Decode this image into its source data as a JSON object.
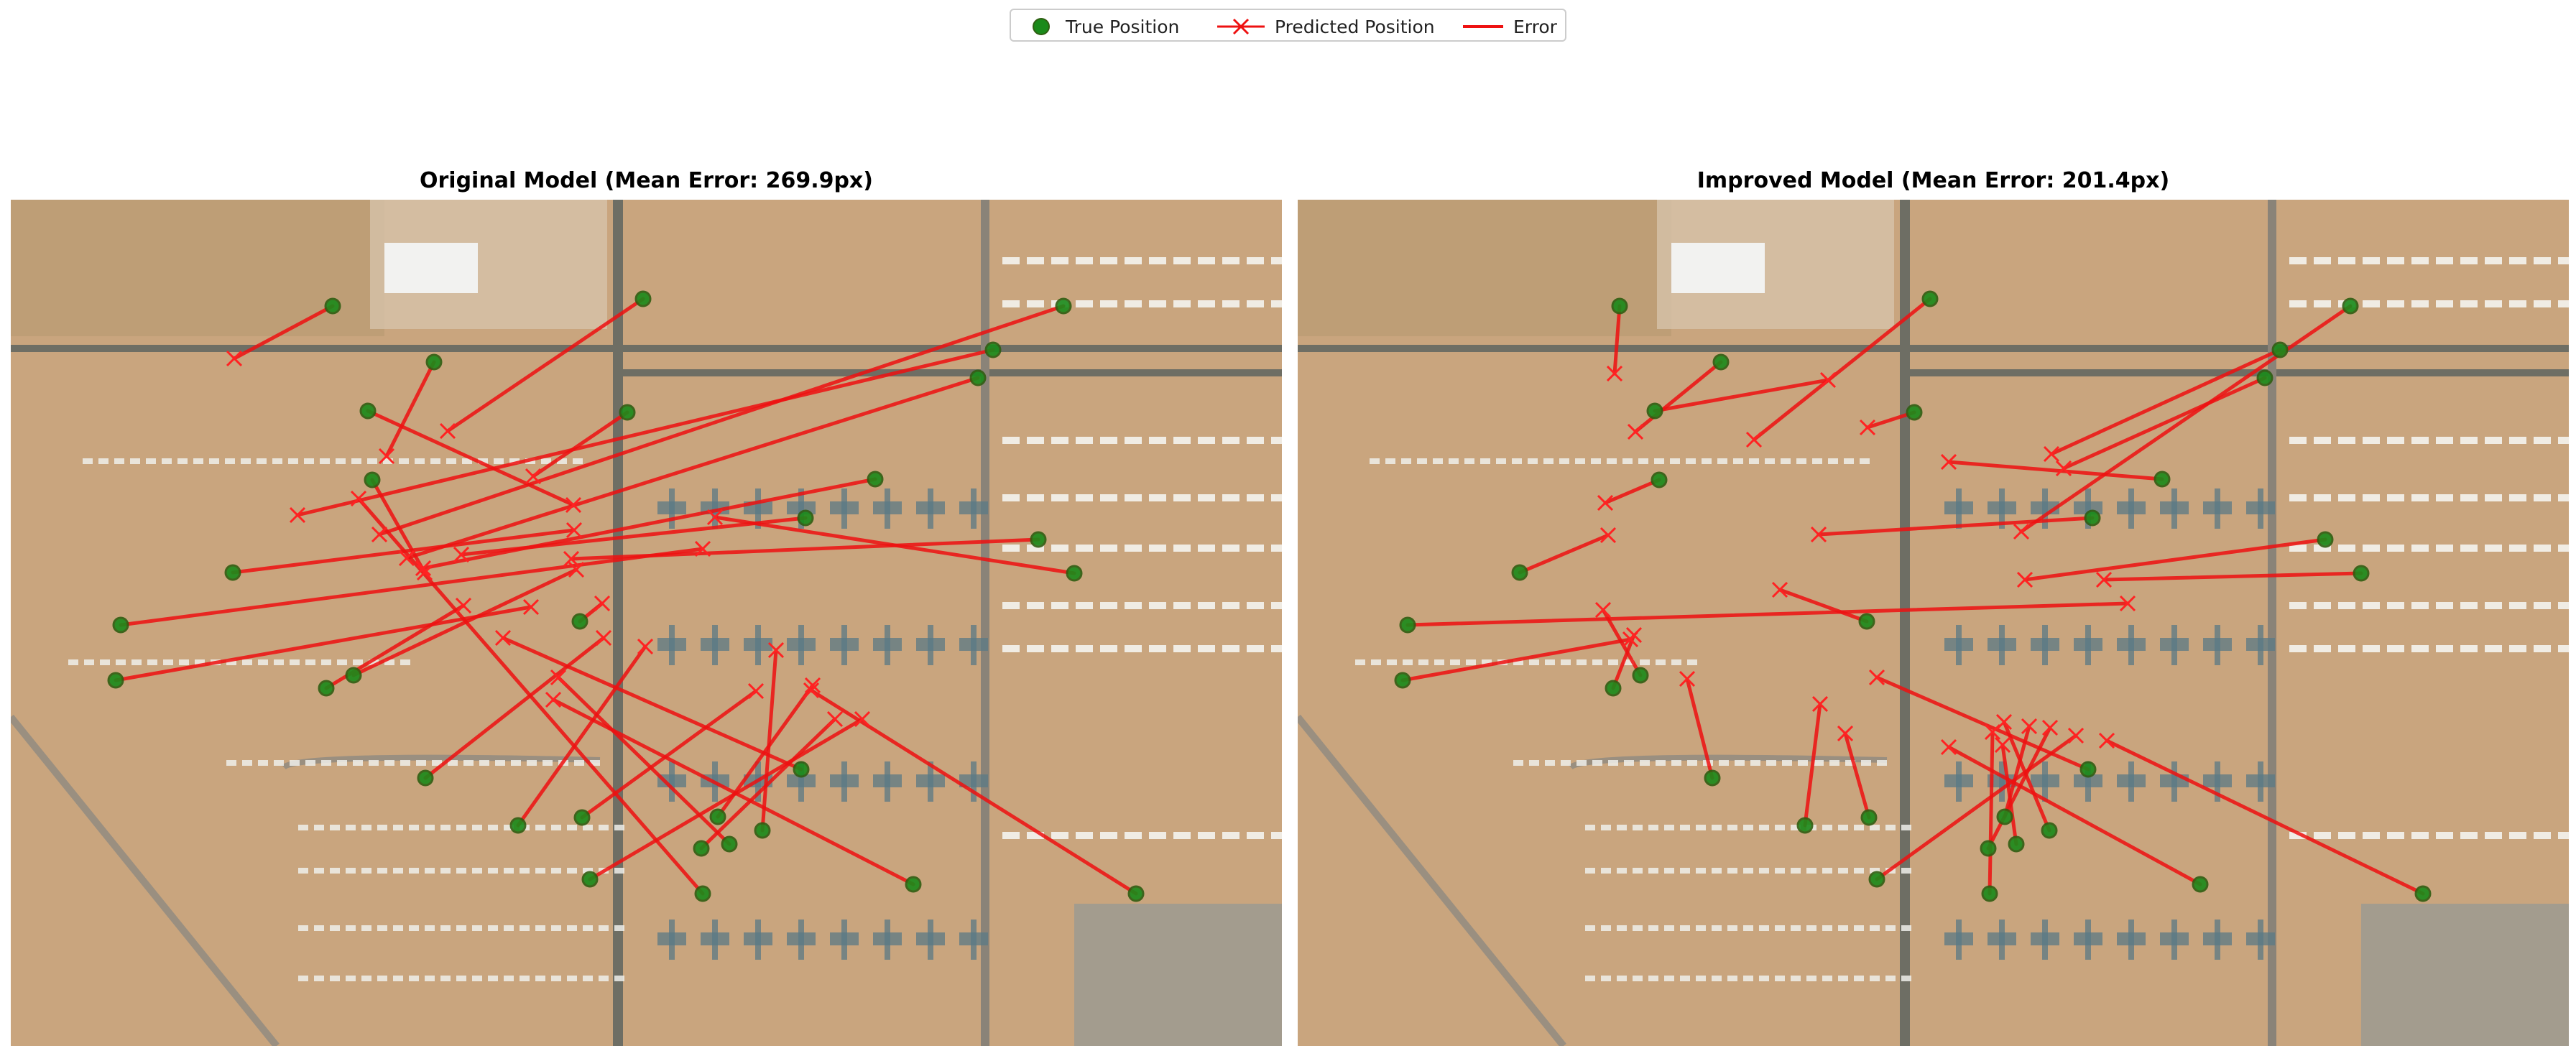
{
  "legend": {
    "true_label": "True Position",
    "pred_label": "Predicted Position",
    "error_label": "Error"
  },
  "colors": {
    "true_fill": "#1a8a1a",
    "true_edge": "#2f5e12",
    "pred": "#ff2222",
    "error": "#ee1111",
    "ground": "#c9a57e",
    "road": "#6e6e64"
  },
  "chart_data": [
    {
      "type": "scatter",
      "title": "Original Model (Mean Error: 269.9px)",
      "grid": false,
      "legend_position": "top-center",
      "series": [
        {
          "name": "True Position",
          "points": [
            [
              448,
              148
            ],
            [
              880,
              138
            ],
            [
              589,
              226
            ],
            [
              497,
              294
            ],
            [
              858,
              296
            ],
            [
              1465,
              148
            ],
            [
              1367,
              209
            ],
            [
              1346,
              248
            ],
            [
              1203,
              389
            ],
            [
              503,
              390
            ],
            [
              309,
              519
            ],
            [
              1106,
              443
            ],
            [
              1430,
              473
            ],
            [
              1480,
              520
            ],
            [
              153,
              592
            ],
            [
              792,
              587
            ],
            [
              477,
              662
            ],
            [
              439,
              680
            ],
            [
              146,
              669
            ],
            [
              577,
              805
            ],
            [
              1100,
              793
            ],
            [
              706,
              871
            ],
            [
              1046,
              878
            ],
            [
              795,
              860
            ],
            [
              984,
              859
            ],
            [
              1000,
              897
            ],
            [
              961,
              903
            ],
            [
              806,
              946
            ],
            [
              1256,
              953
            ],
            [
              963,
              966
            ],
            [
              1566,
              966
            ]
          ]
        },
        {
          "name": "Predicted Position",
          "points": [
            [
              311,
              221
            ],
            [
              608,
              322
            ],
            [
              523,
              357
            ],
            [
              783,
              425
            ],
            [
              727,
              385
            ],
            [
              513,
              466
            ],
            [
              399,
              439
            ],
            [
              551,
              499
            ],
            [
              574,
              513
            ],
            [
              576,
              519
            ],
            [
              784,
              460
            ],
            [
              627,
              494
            ],
            [
              780,
              500
            ],
            [
              980,
              442
            ],
            [
              963,
              486
            ],
            [
              823,
              562
            ],
            [
              787,
              515
            ],
            [
              630,
              565
            ],
            [
              724,
              567
            ],
            [
              825,
              610
            ],
            [
              685,
              610
            ],
            [
              883,
              622
            ],
            [
              1065,
              627
            ],
            [
              1037,
              684
            ],
            [
              1116,
              676
            ],
            [
              762,
              665
            ],
            [
              1147,
              723
            ],
            [
              1185,
              723
            ],
            [
              755,
              696
            ],
            [
              484,
              416
            ],
            [
              1114,
              683
            ]
          ]
        }
      ]
    },
    {
      "type": "scatter",
      "title": "Improved Model (Mean Error: 201.4px)",
      "grid": false,
      "legend_position": "top-center",
      "series": [
        {
          "name": "True Position",
          "points": [
            [
              448,
              148
            ],
            [
              880,
              138
            ],
            [
              589,
              226
            ],
            [
              497,
              294
            ],
            [
              858,
              296
            ],
            [
              1465,
              148
            ],
            [
              1367,
              209
            ],
            [
              1346,
              248
            ],
            [
              1203,
              389
            ],
            [
              503,
              390
            ],
            [
              309,
              519
            ],
            [
              1106,
              443
            ],
            [
              1430,
              473
            ],
            [
              1480,
              520
            ],
            [
              153,
              592
            ],
            [
              792,
              587
            ],
            [
              477,
              662
            ],
            [
              439,
              680
            ],
            [
              146,
              669
            ],
            [
              577,
              805
            ],
            [
              1100,
              793
            ],
            [
              706,
              871
            ],
            [
              1046,
              878
            ],
            [
              795,
              860
            ],
            [
              984,
              859
            ],
            [
              1000,
              897
            ],
            [
              961,
              903
            ],
            [
              806,
              946
            ],
            [
              1256,
              953
            ],
            [
              963,
              966
            ],
            [
              1566,
              966
            ]
          ]
        },
        {
          "name": "Predicted Position",
          "points": [
            [
              441,
              242
            ],
            [
              635,
              334
            ],
            [
              470,
              323
            ],
            [
              738,
              251
            ],
            [
              793,
              317
            ],
            [
              1007,
              462
            ],
            [
              1049,
              354
            ],
            [
              1066,
              374
            ],
            [
              906,
              365
            ],
            [
              428,
              422
            ],
            [
              432,
              467
            ],
            [
              725,
              466
            ],
            [
              1012,
              529
            ],
            [
              1122,
              529
            ],
            [
              1155,
              562
            ],
            [
              671,
              543
            ],
            [
              425,
              571
            ],
            [
              468,
              606
            ],
            [
              463,
              612
            ],
            [
              542,
              667
            ],
            [
              806,
              665
            ],
            [
              727,
              702
            ],
            [
              983,
              727
            ],
            [
              762,
              743
            ],
            [
              1018,
              733
            ],
            [
              981,
              759
            ],
            [
              1047,
              735
            ],
            [
              1083,
              746
            ],
            [
              906,
              762
            ],
            [
              967,
              741
            ],
            [
              1126,
              753
            ]
          ]
        }
      ]
    }
  ]
}
